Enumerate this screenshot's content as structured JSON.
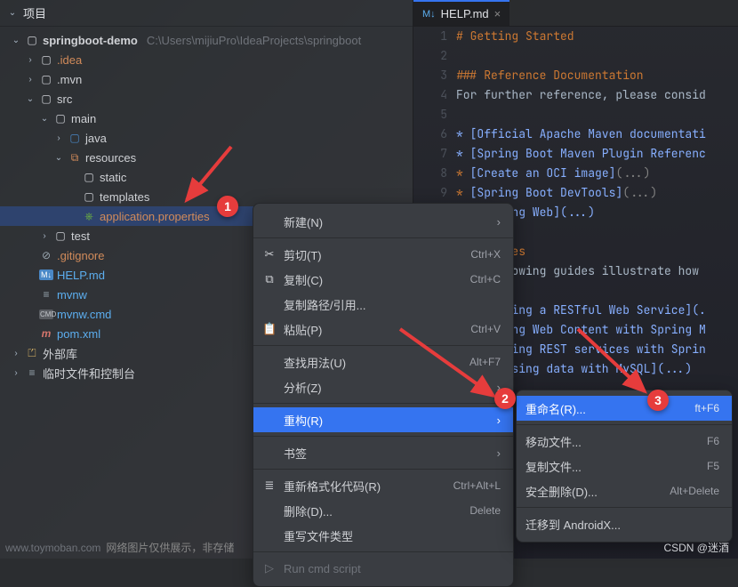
{
  "panel": {
    "title": "项目"
  },
  "project": {
    "root": "springboot-demo",
    "root_path": "C:\\Users\\mijiuPro\\IdeaProjects\\springboot",
    "idea": ".idea",
    "mvn": ".mvn",
    "src": "src",
    "main": "main",
    "java": "java",
    "resources": "resources",
    "static": "static",
    "templates": "templates",
    "app_props": "application.properties",
    "test": "test",
    "gitignore": ".gitignore",
    "help": "HELP.md",
    "mvnw": "mvnw",
    "mvnw_cmd": "mvnw.cmd",
    "pom": "pom.xml",
    "ext_lib": "外部库",
    "scratch": "临时文件和控制台"
  },
  "tab": {
    "label": "HELP.md"
  },
  "editor": {
    "gutter": [
      "1",
      "2",
      "3",
      "4",
      "5",
      "6",
      "7",
      "8",
      "9",
      "",
      "",
      "",
      "",
      "",
      "",
      "",
      "",
      "",
      ""
    ],
    "lines": [
      {
        "cls": "md-h",
        "t": "# Getting Started"
      },
      {
        "cls": "",
        "t": ""
      },
      {
        "cls": "md-h",
        "t": "### Reference Documentation"
      },
      {
        "cls": "md-txt",
        "t": "For further reference, please consid"
      },
      {
        "cls": "",
        "t": ""
      },
      {
        "cls": "md-link",
        "t": "* [Official Apache Maven documentati"
      },
      {
        "cls": "md-link",
        "t": "* [Spring Boot Maven Plugin Referenc"
      },
      {
        "cls": "md-link",
        "t": "* [Create an OCI image](...)"
      },
      {
        "cls": "md-link",
        "t": "* [Spring Boot DevTools](...)"
      },
      {
        "cls": "md-link",
        "t": "      ring Web](...)"
      },
      {
        "cls": "",
        "t": ""
      },
      {
        "cls": "md-h",
        "t": "     uides"
      },
      {
        "cls": "md-txt",
        "t": "     ollowing guides illustrate how "
      },
      {
        "cls": "",
        "t": ""
      },
      {
        "cls": "md-link",
        "t": "     ilding a RESTful Web Service](."
      },
      {
        "cls": "md-link",
        "t": "     rving Web Content with Spring M"
      },
      {
        "cls": "md-link",
        "t": "     ilding REST services with Sprin"
      },
      {
        "cls": "md-link",
        "t": "     cessing data with MySQL](...)"
      },
      {
        "cls": "",
        "t": ""
      }
    ]
  },
  "menu": {
    "new": "新建(N)",
    "cut": "剪切(T)",
    "cut_sc": "Ctrl+X",
    "copy": "复制(C)",
    "copy_sc": "Ctrl+C",
    "copy_path": "复制路径/引用...",
    "paste": "粘贴(P)",
    "paste_sc": "Ctrl+V",
    "find_usages": "查找用法(U)",
    "find_sc": "Alt+F7",
    "analyze": "分析(Z)",
    "refactor": "重构(R)",
    "bookmarks": "书签",
    "reformat": "重新格式化代码(R)",
    "reformat_sc": "Ctrl+Alt+L",
    "delete": "删除(D)...",
    "delete_sc": "Delete",
    "override": "重写文件类型",
    "run_script": "Run cmd script"
  },
  "submenu": {
    "rename": "重命名(R)...",
    "rename_sc": "ft+F6",
    "move": "移动文件...",
    "move_sc": "F6",
    "copy_file": "复制文件...",
    "copy_sc": "F5",
    "safe_del": "安全删除(D)...",
    "safe_sc": "Alt+Delete",
    "migrate": "迁移到 AndroidX..."
  },
  "badges": {
    "b1": "1",
    "b2": "2",
    "b3": "3"
  },
  "watermark": {
    "left1": "www.toymoban.com",
    "left2": "网络图片仅供展示，非存储",
    "right": "CSDN @迷酒"
  }
}
